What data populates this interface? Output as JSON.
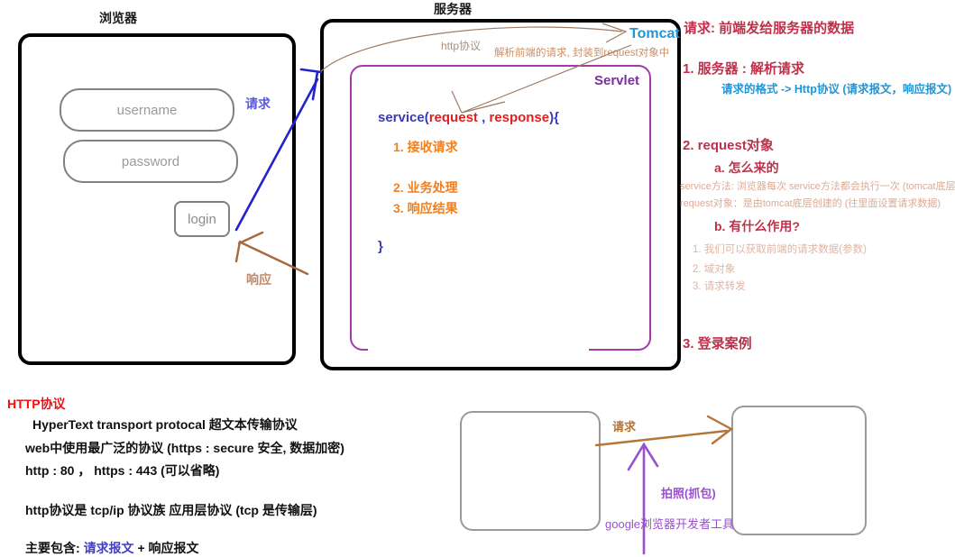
{
  "diagram": {
    "captions": {
      "browser": "浏览器",
      "server": "服务器"
    },
    "browser": {
      "username_placeholder": "username",
      "password_placeholder": "password",
      "login_label": "login",
      "request_arrow_label": "请求",
      "response_arrow_label": "响应"
    },
    "server": {
      "tomcat_label": "Tomcat",
      "servlet_label": "Servlet",
      "http_protocol_label": "http协议",
      "parse_note": "解析前端的请求, 封装到request对象中",
      "service_signature": {
        "part1": "service(",
        "request": "request",
        "separator": " , ",
        "response": "response",
        "part2": "){"
      },
      "steps": [
        "1. 接收请求",
        "2. 业务处理",
        "3. 响应结果"
      ],
      "closing_brace": "}"
    }
  },
  "notes_panel": {
    "heading_request": "请求: 前端发给服务器的数据",
    "item1_title": "1. 服务器 : 解析请求",
    "item1_detail": "请求的格式  -> Http协议 (请求报文，响应报文)",
    "item2_title": "2. request对象",
    "item2_a_title": "a. 怎么来的",
    "item2_a_line1": "service方法: 浏览器每次 service方法都会执行一次 (tomcat底层)",
    "item2_a_line2": "request对象：是由tomcat底层创建的 (往里面设置请求数据)",
    "item2_b_title": "b. 有什么作用?",
    "item2_b_list": [
      "1. 我们可以获取前端的请求数据(参数)",
      "2. 域对象",
      "3. 请求转发"
    ],
    "item3_title": "3. 登录案例"
  },
  "http_notes": {
    "title": "HTTP协议",
    "line1": "HyperText  transport protocal 超文本传输协议",
    "line2": "web中使用最广泛的协议 (https : secure 安全, 数据加密)",
    "line3": "http : 80 ，   https : 443  (可以省略)",
    "line4": "http协议是 tcp/ip 协议族  应用层协议  (tcp 是传输层)",
    "line5_prefix": "主要包含: ",
    "line5_accent": "请求报文",
    "line5_suffix": " + 响应报文"
  },
  "capture_diagram": {
    "request_label": "请求",
    "capture_label": "拍照(抓包)",
    "tool_label": "google浏览器开发者工具"
  },
  "colors": {
    "black_border": "#000000",
    "servlet_purple": "#a23ba8",
    "tomcat_blue": "#2196d6",
    "step_orange": "#f08020",
    "notes_red": "#c0304a",
    "title_red": "#ee1111",
    "blue_arrow": "#2222cc",
    "brown_arrow": "#b5743a",
    "purple_arrow": "#9b4fcf",
    "tan_text": "#dbaa94"
  }
}
